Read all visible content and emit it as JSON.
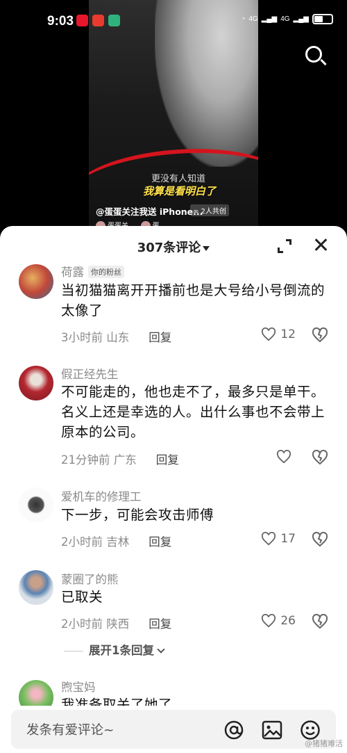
{
  "status_bar": {
    "time": "9:03",
    "signal1": "4G",
    "signal2": "4G"
  },
  "video": {
    "overlay_line1": "更没有人知道",
    "overlay_line2": "我算是看明白了",
    "caption": "@蛋蛋关注我送 iPhone...",
    "coop_badge": "2人共创",
    "mini_user1": "蛋蛋关...",
    "mini_user2": "蛋..."
  },
  "panel": {
    "count_label": "307条评论"
  },
  "comments": [
    {
      "name": "荷露",
      "badge": "你的粉丝",
      "text": "当初猫猫离开开播前也是大号给小号倒流的太像了",
      "time": "3小时前",
      "location": "山东",
      "reply": "回复",
      "likes": "12"
    },
    {
      "name": "假正经先生",
      "text": "不可能走的，他也走不了，最多只是单干。名义上还是幸选的人。出什么事也不会带上原本的公司。",
      "time": "21分钟前",
      "location": "广东",
      "reply": "回复",
      "likes": ""
    },
    {
      "name": "爱机车的修理工",
      "text": "下一步，可能会攻击师傅",
      "time": "2小时前",
      "location": "吉林",
      "reply": "回复",
      "likes": "17"
    },
    {
      "name": "蒙圈了的熊",
      "text": "已取关",
      "time": "2小时前",
      "location": "陕西",
      "reply": "回复",
      "likes": "26"
    },
    {
      "name": "煦宝妈",
      "text": "我准备取关了她了"
    }
  ],
  "expand_replies": "展开1条回复",
  "input": {
    "placeholder": "发条有爱评论~"
  },
  "watermark": "@猪猪难活",
  "colors": {
    "accent_red": "#d4141e",
    "overlay_yellow": "#ffe14a",
    "muted_text": "#8a8a8a"
  }
}
